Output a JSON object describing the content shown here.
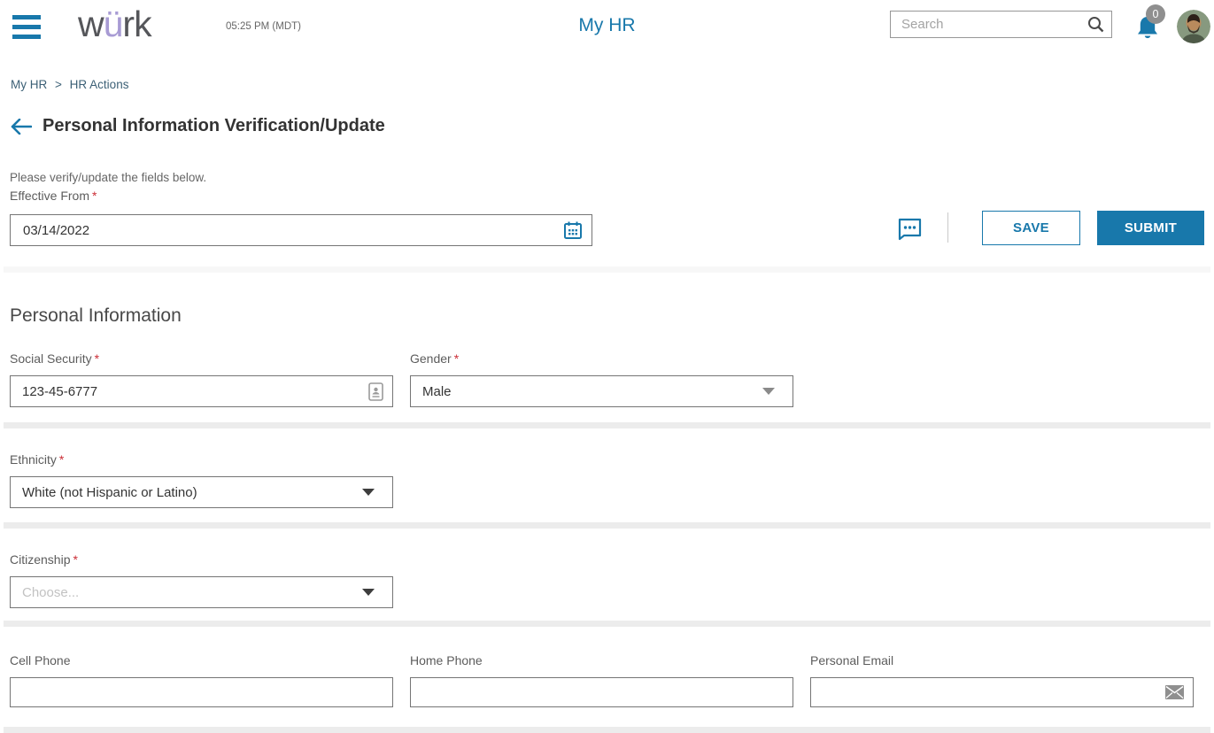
{
  "colors": {
    "accent": "#1878ab",
    "logo_gray": "#55565a",
    "logo_purple": "#a89bd4",
    "required_red": "#cb2e36",
    "badge_gray": "#8f8f8f"
  },
  "icons": {
    "menu": "hamburger-3-bars",
    "search": "magnifier",
    "bell": "notification-bell",
    "avatar": "user-photo",
    "back": "left-arrow",
    "calendar": "calendar-grid",
    "comment": "speech-bubble-ellipsis",
    "ssn": "id-badge",
    "email": "envelope",
    "chevron": "triangle-down"
  },
  "header": {
    "logo_w": "w",
    "logo_u": "ü",
    "logo_rk": "rk",
    "time": "05:25 PM (MDT)",
    "title": "My HR",
    "search_placeholder": "Search",
    "notification_count": "0"
  },
  "breadcrumb": {
    "item1": "My HR",
    "separator": ">",
    "item2": "HR Actions"
  },
  "page": {
    "title": "Personal Information Verification/Update",
    "intro": "Please verify/update the fields below.",
    "required_marker": "*",
    "section_title": "Personal Information"
  },
  "actions": {
    "save": "SAVE",
    "submit": "SUBMIT"
  },
  "form": {
    "effective_from": {
      "label": "Effective From",
      "value": "03/14/2022"
    },
    "social_security": {
      "label": "Social Security",
      "value": "123-45-6777"
    },
    "gender": {
      "label": "Gender",
      "value": "Male"
    },
    "ethnicity": {
      "label": "Ethnicity",
      "value": "White (not Hispanic or Latino)"
    },
    "citizenship": {
      "label": "Citizenship",
      "placeholder": "Choose..."
    },
    "cell_phone": {
      "label": "Cell Phone",
      "value": ""
    },
    "home_phone": {
      "label": "Home Phone",
      "value": ""
    },
    "personal_email": {
      "label": "Personal Email",
      "value": ""
    }
  }
}
